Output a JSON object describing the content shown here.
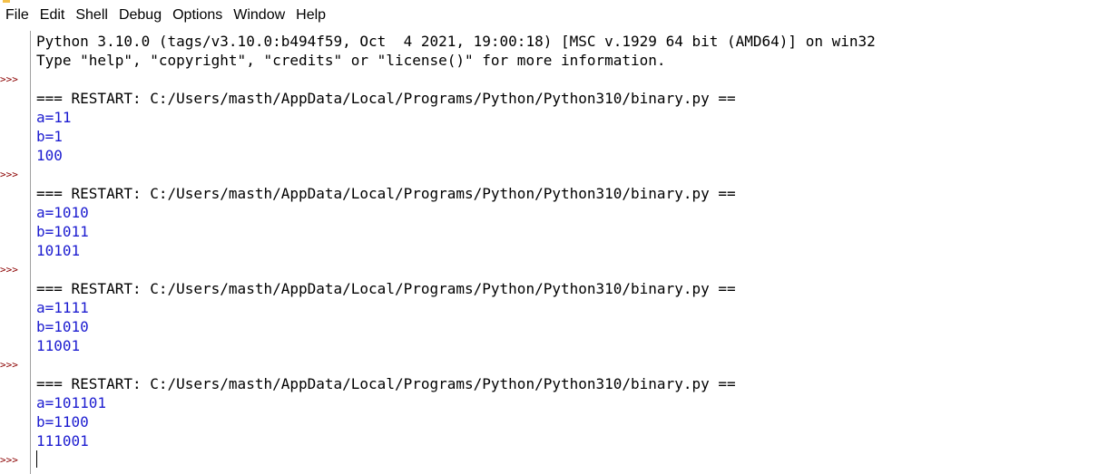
{
  "menu": {
    "items": [
      "File",
      "Edit",
      "Shell",
      "Debug",
      "Options",
      "Window",
      "Help"
    ]
  },
  "colors": {
    "prompt": "#8b0000",
    "stdout": "#1c1cd0",
    "text": "#000000",
    "restart_accent": "#f4c04a"
  },
  "shell": {
    "banner_line1": "Python 3.10.0 (tags/v3.10.0:b494f59, Oct  4 2021, 19:00:18) [MSC v.1929 64 bit (AMD64)] on win32",
    "banner_line2": "Type \"help\", \"copyright\", \"credits\" or \"license()\" for more information.",
    "prompt": ">>>",
    "runs": [
      {
        "restart": "=== RESTART: C:/Users/masth/AppData/Local/Programs/Python/Python310/binary.py ==",
        "a": "a=11",
        "b": "b=1",
        "result": "100"
      },
      {
        "restart": "=== RESTART: C:/Users/masth/AppData/Local/Programs/Python/Python310/binary.py ==",
        "a": "a=1010",
        "b": "b=1011",
        "result": "10101"
      },
      {
        "restart": "=== RESTART: C:/Users/masth/AppData/Local/Programs/Python/Python310/binary.py ==",
        "a": "a=1111",
        "b": "b=1010",
        "result": "11001"
      },
      {
        "restart": "=== RESTART: C:/Users/masth/AppData/Local/Programs/Python/Python310/binary.py ==",
        "a": "a=101101",
        "b": "b=1100",
        "result": "111001"
      }
    ]
  }
}
